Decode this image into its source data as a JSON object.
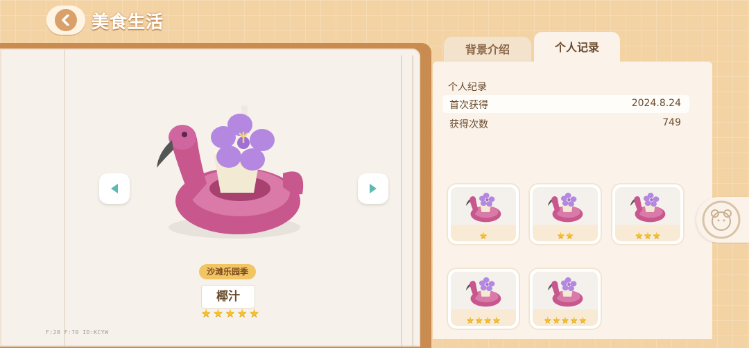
{
  "header": {
    "title": "美食生活"
  },
  "tabs": [
    {
      "label": "背景介绍",
      "active": false
    },
    {
      "label": "个人记录",
      "active": true
    }
  ],
  "record": {
    "title": "个人纪录",
    "rows": [
      {
        "key": "首次获得",
        "value": "2024.8.24"
      },
      {
        "key": "获得次数",
        "value": "749"
      }
    ]
  },
  "item": {
    "season": "沙滩乐园季",
    "name": "椰汁",
    "stars": 5
  },
  "variants": [
    {
      "stars": 1
    },
    {
      "stars": 2
    },
    {
      "stars": 3
    },
    {
      "stars": 4
    },
    {
      "stars": 5
    }
  ],
  "debug": {
    "text": "F:28   F:70   ID:KCYW"
  },
  "colors": {
    "accent": "#d9a06a",
    "star": "#f5c12e",
    "flamingo": "#c7578d",
    "flower": "#b487e0"
  },
  "icons": {
    "back": "chevron-left-icon",
    "prev": "triangle-left-icon",
    "next": "triangle-right-icon",
    "side": "bear-icon"
  }
}
